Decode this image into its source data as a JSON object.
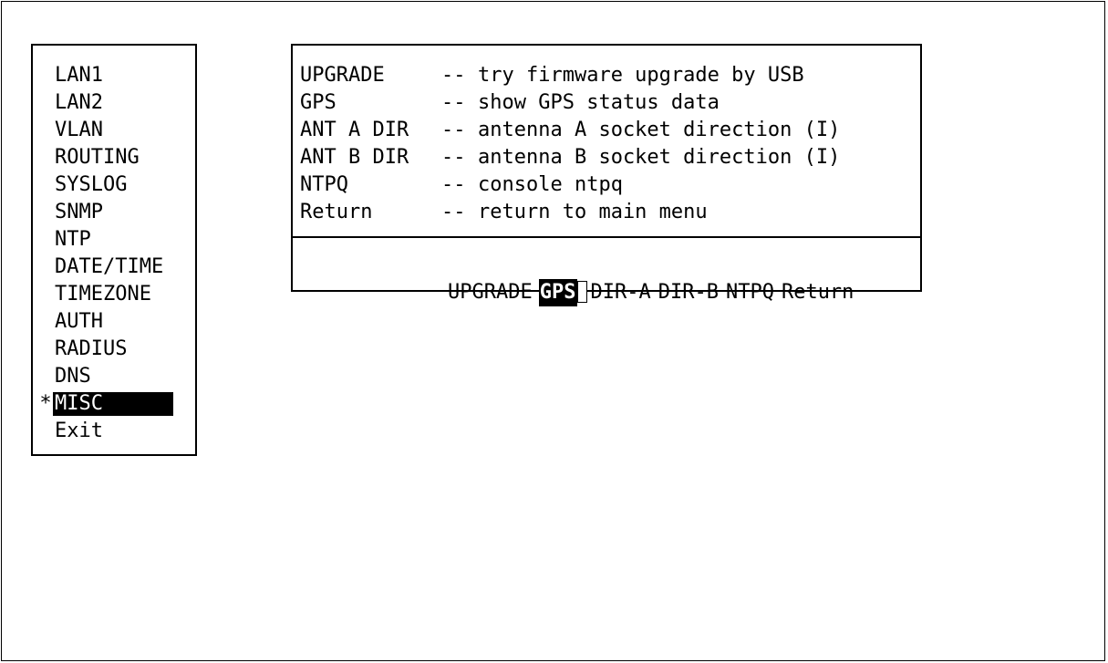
{
  "main_menu": {
    "items": [
      {
        "label": "LAN1",
        "marker": ""
      },
      {
        "label": "LAN2",
        "marker": ""
      },
      {
        "label": "VLAN",
        "marker": ""
      },
      {
        "label": "ROUTING",
        "marker": ""
      },
      {
        "label": "SYSLOG",
        "marker": ""
      },
      {
        "label": "SNMP",
        "marker": ""
      },
      {
        "label": "NTP",
        "marker": ""
      },
      {
        "label": "DATE/TIME",
        "marker": ""
      },
      {
        "label": "TIMEZONE",
        "marker": ""
      },
      {
        "label": "AUTH",
        "marker": ""
      },
      {
        "label": "RADIUS",
        "marker": ""
      },
      {
        "label": "DNS",
        "marker": ""
      },
      {
        "label": "MISC",
        "marker": "*"
      },
      {
        "label": "Exit",
        "marker": ""
      }
    ],
    "selected_label": "MISC"
  },
  "submenu": {
    "descriptions": [
      {
        "key": "UPGRADE",
        "sep": "--",
        "text": "try firmware upgrade by USB"
      },
      {
        "key": "GPS",
        "sep": "--",
        "text": "show GPS status data"
      },
      {
        "key": "ANT A DIR",
        "sep": "--",
        "text": "antenna A socket direction (I)"
      },
      {
        "key": "ANT B DIR",
        "sep": "--",
        "text": "antenna B socket direction (I)"
      },
      {
        "key": "NTPQ",
        "sep": "--",
        "text": "console ntpq"
      },
      {
        "key": "Return",
        "sep": "--",
        "text": "return to main menu"
      }
    ],
    "actions": [
      "UPGRADE",
      "GPS",
      "DIR-A",
      "DIR-B",
      "NTPQ",
      "Return"
    ],
    "selected_action": "GPS"
  },
  "colors": {
    "background": "#ffffff",
    "foreground": "#000000",
    "highlight": "#000000"
  }
}
